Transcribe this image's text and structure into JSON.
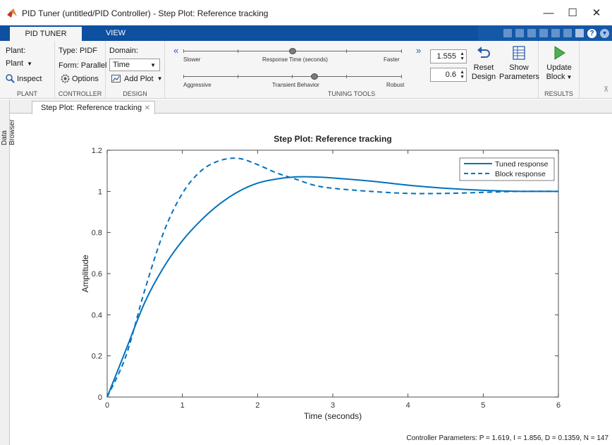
{
  "window": {
    "title": "PID Tuner (untitled/PID Controller) - Step Plot: Reference tracking",
    "minimize_glyph": "—",
    "maximize_glyph": "☐",
    "close_glyph": "✕"
  },
  "tabs": [
    {
      "label": "PID TUNER",
      "active": true
    },
    {
      "label": "VIEW",
      "active": false
    }
  ],
  "ribbon": {
    "plant": {
      "label": "Plant:",
      "dropdown": "Plant",
      "inspect": "Inspect",
      "section": "PLANT"
    },
    "controller": {
      "type": "Type: PIDF",
      "form": "Form: Parallel",
      "options": "Options",
      "section": "CONTROLLER"
    },
    "design": {
      "domain_label": "Domain:",
      "domain_value": "Time",
      "add_plot": "Add Plot",
      "section": "DESIGN"
    },
    "tuning": {
      "response_time_left": "Slower",
      "response_time_center": "Response Time (seconds)",
      "response_time_right": "Faster",
      "response_time_value": "1.555",
      "response_time_level": 0.5,
      "transient_left": "Aggressive",
      "transient_center": "Transient Behavior",
      "transient_right": "Robust",
      "transient_value": "0.6",
      "transient_level": 0.6,
      "reset_label_1": "Reset",
      "reset_label_2": "Design",
      "show_label_1": "Show",
      "show_label_2": "Parameters",
      "section": "TUNING TOOLS"
    },
    "results": {
      "update_label_1": "Update",
      "update_label_2": "Block",
      "section": "RESULTS"
    }
  },
  "sidebar": {
    "label": "Data Browser"
  },
  "document_tab": {
    "label": "Step Plot: Reference tracking",
    "close": "✕"
  },
  "status_text": "Controller Parameters: P = 1.619, I = 1.856, D = 0.1359, N = 147",
  "colors": {
    "line": "#0072bd",
    "tab_bar": "#0e4fa0"
  },
  "chart_data": {
    "type": "line",
    "title": "Step Plot: Reference tracking",
    "xlabel": "Time (seconds)",
    "ylabel": "Amplitude",
    "xlim": [
      0,
      6
    ],
    "ylim": [
      0,
      1.2
    ],
    "xticks": [
      0,
      1,
      2,
      3,
      4,
      5,
      6
    ],
    "yticks": [
      0,
      0.2,
      0.4,
      0.6,
      0.8,
      1,
      1.2
    ],
    "ytick_labels": [
      "0",
      "0.2",
      "0.4",
      "0.6",
      "0.8",
      "1",
      "1.2"
    ],
    "grid": false,
    "legend_position": "top-right",
    "series": [
      {
        "name": "Tuned response",
        "style": "solid",
        "x": [
          0,
          0.25,
          0.5,
          0.75,
          1.0,
          1.25,
          1.5,
          1.75,
          2.0,
          2.25,
          2.5,
          2.75,
          3.0,
          3.5,
          4.0,
          4.5,
          5.0,
          5.5,
          6.0
        ],
        "y": [
          0,
          0.23,
          0.46,
          0.63,
          0.76,
          0.86,
          0.94,
          1.0,
          1.04,
          1.06,
          1.07,
          1.07,
          1.065,
          1.05,
          1.03,
          1.015,
          1.005,
          1.0,
          1.0
        ]
      },
      {
        "name": "Block response",
        "style": "dashed",
        "x": [
          0,
          0.25,
          0.5,
          0.75,
          1.0,
          1.25,
          1.5,
          1.75,
          2.0,
          2.25,
          2.5,
          2.75,
          3.0,
          3.5,
          4.0,
          4.5,
          5.0,
          5.5,
          6.0
        ],
        "y": [
          0,
          0.2,
          0.52,
          0.8,
          0.99,
          1.1,
          1.15,
          1.16,
          1.13,
          1.09,
          1.06,
          1.03,
          1.015,
          1.0,
          0.99,
          0.99,
          0.995,
          1.0,
          1.0
        ]
      }
    ]
  }
}
